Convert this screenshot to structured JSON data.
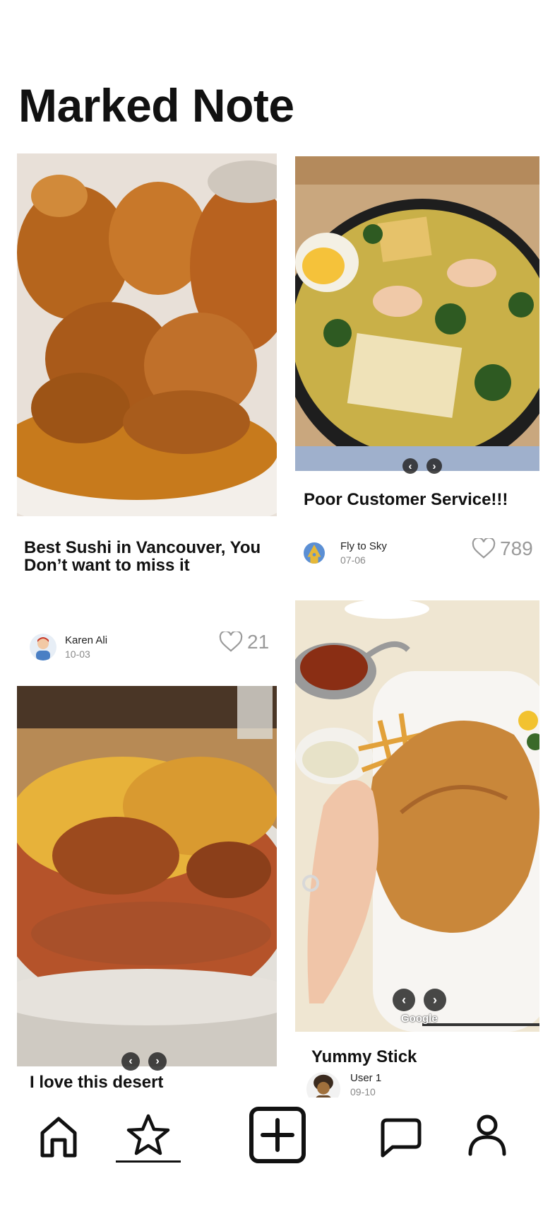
{
  "page": {
    "title": "Marked Note"
  },
  "posts": [
    {
      "title": "Best Sushi in Vancouver, You Don’t want to miss it",
      "author": "Karen  Ali",
      "date": "10-03",
      "likes": "21",
      "image": "fried-chicken-photo"
    },
    {
      "title": "Poor Customer Service!!!",
      "author": "Fly to Sky",
      "date": "07-06",
      "likes": "789",
      "image": "seafood-soup-photo"
    },
    {
      "title": "I love this desert",
      "image": "baked-dish-photo"
    },
    {
      "title": "Yummy Stick",
      "author": "User 1",
      "date": "09-10",
      "image": "fried-cutlet-photo",
      "watermark": "Google"
    }
  ],
  "carousel": {
    "prev": "‹",
    "next": "›"
  },
  "tabbar": {
    "items": [
      {
        "name": "home",
        "icon": "home-icon"
      },
      {
        "name": "marked",
        "icon": "star-icon",
        "active": true
      },
      {
        "name": "create",
        "icon": "plus-square-icon"
      },
      {
        "name": "messages",
        "icon": "chat-bubble-icon"
      },
      {
        "name": "profile",
        "icon": "person-icon"
      }
    ]
  }
}
